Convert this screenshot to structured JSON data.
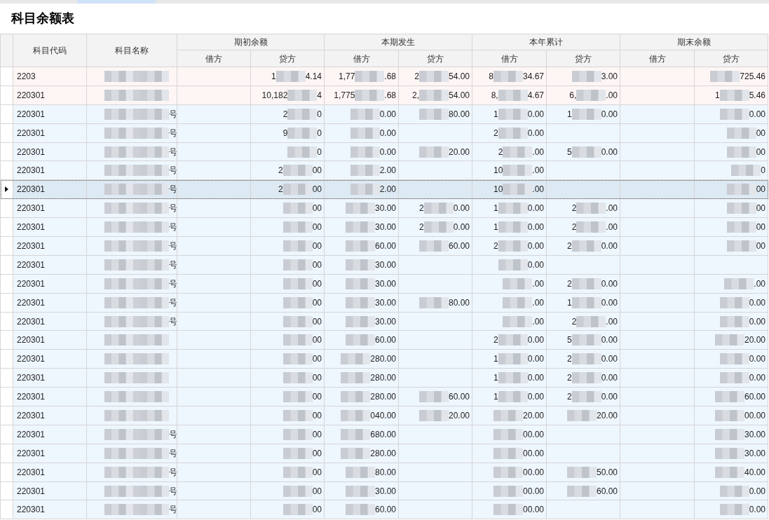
{
  "title": "科目余额表",
  "columns": {
    "code": "科目代码",
    "name": "科目名称",
    "groups": [
      {
        "label": "期初余额",
        "sub": [
          "借方",
          "贷方"
        ]
      },
      {
        "label": "本期发生",
        "sub": [
          "借方",
          "贷方"
        ]
      },
      {
        "label": "本年累计",
        "sub": [
          "借方",
          "贷方"
        ]
      },
      {
        "label": "期末余额",
        "sub": [
          "借方",
          "贷方"
        ]
      }
    ]
  },
  "rows": [
    {
      "code": "2203",
      "kind": "summary",
      "selected": false,
      "cells": [
        {
          "redacted": true
        },
        null,
        {
          "pre": "1",
          "post": "4.14",
          "redacted": true
        },
        {
          "pre": "1,77",
          "post": ".68",
          "redacted": true
        },
        {
          "pre": "2",
          "post": "54.00",
          "redacted": true
        },
        {
          "pre": "8",
          "post": "34.67",
          "redacted": true
        },
        {
          "post": "3.00",
          "redacted": true
        },
        null,
        {
          "post": "725.46",
          "redacted": true
        }
      ]
    },
    {
      "code": "220301",
      "kind": "summary",
      "selected": false,
      "cells": [
        {
          "redacted": true
        },
        null,
        {
          "pre": "10,182",
          "post": "4",
          "redacted": true
        },
        {
          "pre": "1,775",
          "post": ".68",
          "redacted": true
        },
        {
          "pre": "2,",
          "post": "54.00",
          "redacted": true
        },
        {
          "pre": "8,",
          "post": "4.67",
          "redacted": true
        },
        {
          "pre": "6,",
          "post": ".00",
          "redacted": true
        },
        null,
        {
          "pre": "1",
          "post": "5.46",
          "redacted": true
        }
      ]
    },
    {
      "code": "220301",
      "kind": "detail",
      "selected": false,
      "cells": [
        {
          "post": "号",
          "redacted": true
        },
        null,
        {
          "pre": "2",
          "post": "0",
          "redacted": true
        },
        {
          "post": "0.00",
          "redacted": true
        },
        {
          "post": "80.00",
          "redacted": true
        },
        {
          "pre": "1",
          "post": "0.00",
          "redacted": true
        },
        {
          "pre": "1",
          "post": "0.00",
          "redacted": true
        },
        null,
        {
          "post": "0.00",
          "redacted": true
        }
      ]
    },
    {
      "code": "220301",
      "kind": "detail",
      "selected": false,
      "cells": [
        {
          "post": "号",
          "redacted": true
        },
        null,
        {
          "pre": "9",
          "post": "0",
          "redacted": true
        },
        {
          "post": "0.00",
          "redacted": true
        },
        null,
        {
          "pre": "2",
          "post": "0.00",
          "redacted": true
        },
        null,
        null,
        {
          "post": "00",
          "redacted": true
        }
      ]
    },
    {
      "code": "220301",
      "kind": "detail",
      "selected": false,
      "cells": [
        {
          "post": "号",
          "redacted": true
        },
        null,
        {
          "post": "0",
          "redacted": true
        },
        {
          "post": "0.00",
          "redacted": true
        },
        {
          "post": "20.00",
          "redacted": true
        },
        {
          "pre": "2",
          "post": ".00",
          "redacted": true
        },
        {
          "pre": "5",
          "post": "0.00",
          "redacted": true
        },
        null,
        {
          "post": "00",
          "redacted": true
        }
      ]
    },
    {
      "code": "220301",
      "kind": "detail",
      "selected": false,
      "cells": [
        {
          "post": "号",
          "redacted": true
        },
        null,
        {
          "pre": "2",
          "post": "00",
          "redacted": true
        },
        {
          "post": "2.00",
          "redacted": true
        },
        null,
        {
          "pre": "10",
          "post": ".00",
          "redacted": true
        },
        null,
        null,
        {
          "post": "0",
          "redacted": true
        }
      ]
    },
    {
      "code": "220301",
      "kind": "detail",
      "selected": true,
      "cells": [
        {
          "post": "号",
          "redacted": true
        },
        null,
        {
          "pre": "2",
          "post": "00",
          "redacted": true
        },
        {
          "post": "2.00",
          "redacted": true
        },
        null,
        {
          "pre": "10",
          "post": ".00",
          "redacted": true
        },
        null,
        null,
        {
          "post": "00",
          "redacted": true
        }
      ]
    },
    {
      "code": "220301",
      "kind": "detail",
      "selected": false,
      "cells": [
        {
          "post": "号",
          "redacted": true
        },
        null,
        {
          "post": "00",
          "redacted": true
        },
        {
          "post": "30.00",
          "redacted": true
        },
        {
          "pre": "2",
          "post": "0.00",
          "redacted": true
        },
        {
          "pre": "1",
          "post": "0.00",
          "redacted": true
        },
        {
          "pre": "2",
          "post": ".00",
          "redacted": true
        },
        null,
        {
          "post": "00",
          "redacted": true
        }
      ]
    },
    {
      "code": "220301",
      "kind": "detail",
      "selected": false,
      "cells": [
        {
          "post": "号",
          "redacted": true
        },
        null,
        {
          "post": "00",
          "redacted": true
        },
        {
          "post": "30.00",
          "redacted": true
        },
        {
          "pre": "2",
          "post": "0.00",
          "redacted": true
        },
        {
          "pre": "1",
          "post": "0.00",
          "redacted": true
        },
        {
          "pre": "2",
          "post": ".00",
          "redacted": true
        },
        null,
        {
          "post": "00",
          "redacted": true
        }
      ]
    },
    {
      "code": "220301",
      "kind": "detail",
      "selected": false,
      "cells": [
        {
          "post": "号",
          "redacted": true
        },
        null,
        {
          "post": "00",
          "redacted": true
        },
        {
          "post": "60.00",
          "redacted": true
        },
        {
          "post": "60.00",
          "redacted": true
        },
        {
          "pre": "2",
          "post": "0.00",
          "redacted": true
        },
        {
          "pre": "2",
          "post": "0.00",
          "redacted": true
        },
        null,
        {
          "post": "00",
          "redacted": true
        }
      ]
    },
    {
      "code": "220301",
      "kind": "detail",
      "selected": false,
      "cells": [
        {
          "post": "号",
          "redacted": true
        },
        null,
        {
          "post": "00",
          "redacted": true
        },
        {
          "post": "30.00",
          "redacted": true
        },
        null,
        {
          "post": "0.00",
          "redacted": true
        },
        null,
        null,
        null
      ]
    },
    {
      "code": "220301",
      "kind": "detail",
      "selected": false,
      "cells": [
        {
          "post": "号",
          "redacted": true
        },
        null,
        {
          "post": "00",
          "redacted": true
        },
        {
          "post": "30.00",
          "redacted": true
        },
        null,
        {
          "post": ".00",
          "redacted": true
        },
        {
          "pre": "2",
          "post": "0.00",
          "redacted": true
        },
        null,
        {
          "post": ".00",
          "redacted": true
        }
      ]
    },
    {
      "code": "220301",
      "kind": "detail",
      "selected": false,
      "cells": [
        {
          "post": "号",
          "redacted": true
        },
        null,
        {
          "post": "00",
          "redacted": true
        },
        {
          "post": "30.00",
          "redacted": true
        },
        {
          "post": "80.00",
          "redacted": true
        },
        {
          "post": ".00",
          "redacted": true
        },
        {
          "pre": "1",
          "post": "0.00",
          "redacted": true
        },
        null,
        {
          "post": "0.00",
          "redacted": true
        }
      ]
    },
    {
      "code": "220301",
      "kind": "detail",
      "selected": false,
      "cells": [
        {
          "post": "号",
          "redacted": true
        },
        null,
        {
          "post": "00",
          "redacted": true
        },
        {
          "post": "30.00",
          "redacted": true
        },
        null,
        {
          "post": ".00",
          "redacted": true
        },
        {
          "pre": "2",
          "post": ".00",
          "redacted": true
        },
        null,
        {
          "post": "0.00",
          "redacted": true
        }
      ]
    },
    {
      "code": "220301",
      "kind": "detail",
      "selected": false,
      "cells": [
        {
          "redacted": true
        },
        null,
        {
          "post": "00",
          "redacted": true
        },
        {
          "post": "60.00",
          "redacted": true
        },
        null,
        {
          "pre": "2",
          "post": "0.00",
          "redacted": true
        },
        {
          "pre": "5",
          "post": "0.00",
          "redacted": true
        },
        null,
        {
          "post": "20.00",
          "redacted": true
        }
      ]
    },
    {
      "code": "220301",
      "kind": "detail",
      "selected": false,
      "cells": [
        {
          "redacted": true
        },
        null,
        {
          "post": "00",
          "redacted": true
        },
        {
          "post": "280.00",
          "redacted": true
        },
        null,
        {
          "pre": "1",
          "post": "0.00",
          "redacted": true
        },
        {
          "pre": "2",
          "post": "0.00",
          "redacted": true
        },
        null,
        {
          "post": "0.00",
          "redacted": true
        }
      ]
    },
    {
      "code": "220301",
      "kind": "detail",
      "selected": false,
      "cells": [
        {
          "redacted": true
        },
        null,
        {
          "post": "00",
          "redacted": true
        },
        {
          "post": "280.00",
          "redacted": true
        },
        null,
        {
          "pre": "1",
          "post": "0.00",
          "redacted": true
        },
        {
          "pre": "2",
          "post": "0.00",
          "redacted": true
        },
        null,
        {
          "post": "0.00",
          "redacted": true
        }
      ]
    },
    {
      "code": "220301",
      "kind": "detail",
      "selected": false,
      "cells": [
        {
          "redacted": true
        },
        null,
        {
          "post": "00",
          "redacted": true
        },
        {
          "post": "280.00",
          "redacted": true
        },
        {
          "post": "60.00",
          "redacted": true
        },
        {
          "pre": "1",
          "post": "0.00",
          "redacted": true
        },
        {
          "pre": "2",
          "post": "0.00",
          "redacted": true
        },
        null,
        {
          "post": "60.00",
          "redacted": true
        }
      ]
    },
    {
      "code": "220301",
      "kind": "detail",
      "selected": false,
      "cells": [
        {
          "redacted": true
        },
        null,
        {
          "post": "00",
          "redacted": true
        },
        {
          "post": "040.00",
          "redacted": true
        },
        {
          "post": "20.00",
          "redacted": true
        },
        {
          "post": "20.00",
          "redacted": true
        },
        {
          "post": "20.00",
          "redacted": true
        },
        null,
        {
          "post": "00.00",
          "redacted": true
        }
      ]
    },
    {
      "code": "220301",
      "kind": "detail",
      "selected": false,
      "cells": [
        {
          "post": "号",
          "redacted": true
        },
        null,
        {
          "post": "00",
          "redacted": true
        },
        {
          "post": "680.00",
          "redacted": true
        },
        null,
        {
          "post": "00.00",
          "redacted": true
        },
        null,
        null,
        {
          "post": "30.00",
          "redacted": true
        }
      ]
    },
    {
      "code": "220301",
      "kind": "detail",
      "selected": false,
      "cells": [
        {
          "post": "号",
          "redacted": true
        },
        null,
        {
          "post": "00",
          "redacted": true
        },
        {
          "post": "280.00",
          "redacted": true
        },
        null,
        {
          "post": "00.00",
          "redacted": true
        },
        null,
        null,
        {
          "post": "30.00",
          "redacted": true
        }
      ]
    },
    {
      "code": "220301",
      "kind": "detail",
      "selected": false,
      "cells": [
        {
          "post": "号",
          "redacted": true
        },
        null,
        {
          "post": "00",
          "redacted": true
        },
        {
          "post": "80.00",
          "redacted": true
        },
        null,
        {
          "post": "00.00",
          "redacted": true
        },
        {
          "post": "50.00",
          "redacted": true
        },
        null,
        {
          "post": "40.00",
          "redacted": true
        }
      ]
    },
    {
      "code": "220301",
      "kind": "detail",
      "selected": false,
      "cells": [
        {
          "post": "号",
          "redacted": true
        },
        null,
        {
          "post": "00",
          "redacted": true
        },
        {
          "post": "30.00",
          "redacted": true
        },
        null,
        {
          "post": "00.00",
          "redacted": true
        },
        {
          "post": "60.00",
          "redacted": true
        },
        null,
        {
          "post": "0.00",
          "redacted": true
        }
      ]
    },
    {
      "code": "220301",
      "kind": "detail",
      "selected": false,
      "cells": [
        {
          "post": "号",
          "redacted": true
        },
        null,
        {
          "post": "00",
          "redacted": true
        },
        {
          "post": "60.00",
          "redacted": true
        },
        null,
        {
          "post": "00.00",
          "redacted": true
        },
        null,
        null,
        {
          "post": "0.00",
          "redacted": true
        }
      ]
    }
  ]
}
